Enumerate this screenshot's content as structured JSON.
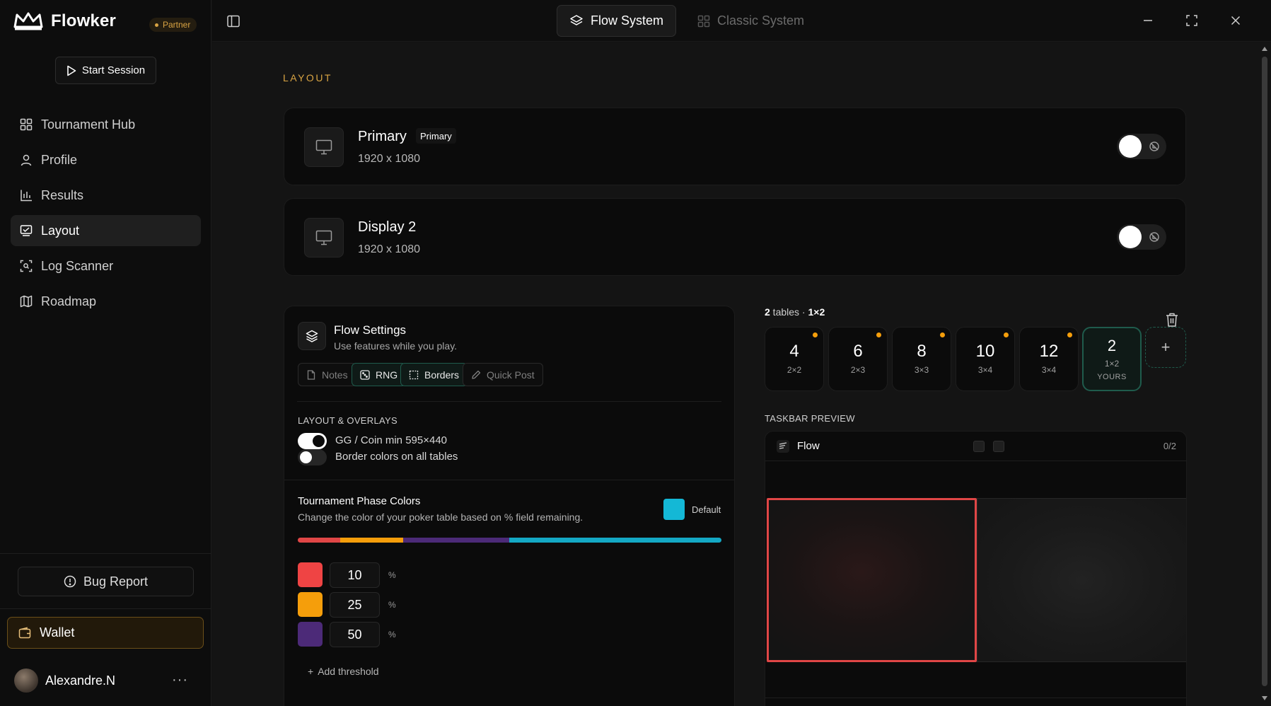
{
  "app": {
    "name": "Flowker",
    "partner_badge": "Partner"
  },
  "sidebar": {
    "start_session": "Start Session",
    "items": [
      {
        "label": "Tournament Hub",
        "icon": "grid-icon"
      },
      {
        "label": "Profile",
        "icon": "user-icon"
      },
      {
        "label": "Results",
        "icon": "chart-bars-icon"
      },
      {
        "label": "Layout",
        "icon": "layout-icon",
        "active": true
      },
      {
        "label": "Log Scanner",
        "icon": "scan-icon"
      },
      {
        "label": "Roadmap",
        "icon": "map-icon"
      }
    ],
    "bug_report": "Bug Report",
    "wallet": "Wallet",
    "user_name": "Alexandre.N",
    "user_more": "···"
  },
  "topbar": {
    "tabs": [
      {
        "label": "Flow System",
        "active": true
      },
      {
        "label": "Classic System",
        "active": false
      }
    ]
  },
  "main": {
    "section_label": "LAYOUT",
    "displays": [
      {
        "name": "Primary",
        "tag": "Primary",
        "resolution": "1920 x 1080"
      },
      {
        "name": "Display 2",
        "tag": "",
        "resolution": "1920 x 1080"
      }
    ],
    "flow_settings": {
      "title": "Flow Settings",
      "subtitle": "Use features while you play.",
      "chips": [
        {
          "label": "Notes",
          "on": false,
          "icon": "file-icon"
        },
        {
          "label": "RNG",
          "on": true,
          "icon": "dice-icon"
        },
        {
          "label": "Borders",
          "on": true,
          "icon": "border-dashed-icon"
        },
        {
          "label": "Quick Post",
          "on": false,
          "icon": "pencil-icon"
        }
      ],
      "layout_overlays_label": "LAYOUT & OVERLAYS",
      "switches": [
        {
          "label": "GG / Coin min 595×440",
          "on": true
        },
        {
          "label": "Border colors on all tables",
          "on": false
        }
      ],
      "phase_colors": {
        "title": "Tournament Phase Colors",
        "subtitle": "Change the color of your poker table based on % field remaining.",
        "default_label": "Default",
        "default_color": "#14b8d6",
        "bar_colors": [
          "#e04646",
          "#f59e0b",
          "#4c2a78",
          "#14a8c4"
        ],
        "thresholds": [
          {
            "value": "10",
            "color": "#ef4444",
            "unit": "%"
          },
          {
            "value": "25",
            "color": "#f59e0b",
            "unit": "%"
          },
          {
            "value": "50",
            "color": "#4c2a78",
            "unit": "%"
          }
        ],
        "add_threshold": "Add threshold"
      }
    },
    "tables": {
      "summary_count": "2",
      "summary_mid": " tables · ",
      "summary_grid": "1×2",
      "tiles": [
        {
          "n": "4",
          "g": "2×2"
        },
        {
          "n": "6",
          "g": "2×3"
        },
        {
          "n": "8",
          "g": "3×3"
        },
        {
          "n": "10",
          "g": "3×4"
        },
        {
          "n": "12",
          "g": "3×4"
        }
      ],
      "selected": {
        "n": "2",
        "g": "1×2",
        "y": "YOURS"
      },
      "add": "+"
    },
    "taskbar_preview": {
      "label": "TASKBAR PREVIEW",
      "title": "Flow",
      "count": "0/2"
    }
  }
}
